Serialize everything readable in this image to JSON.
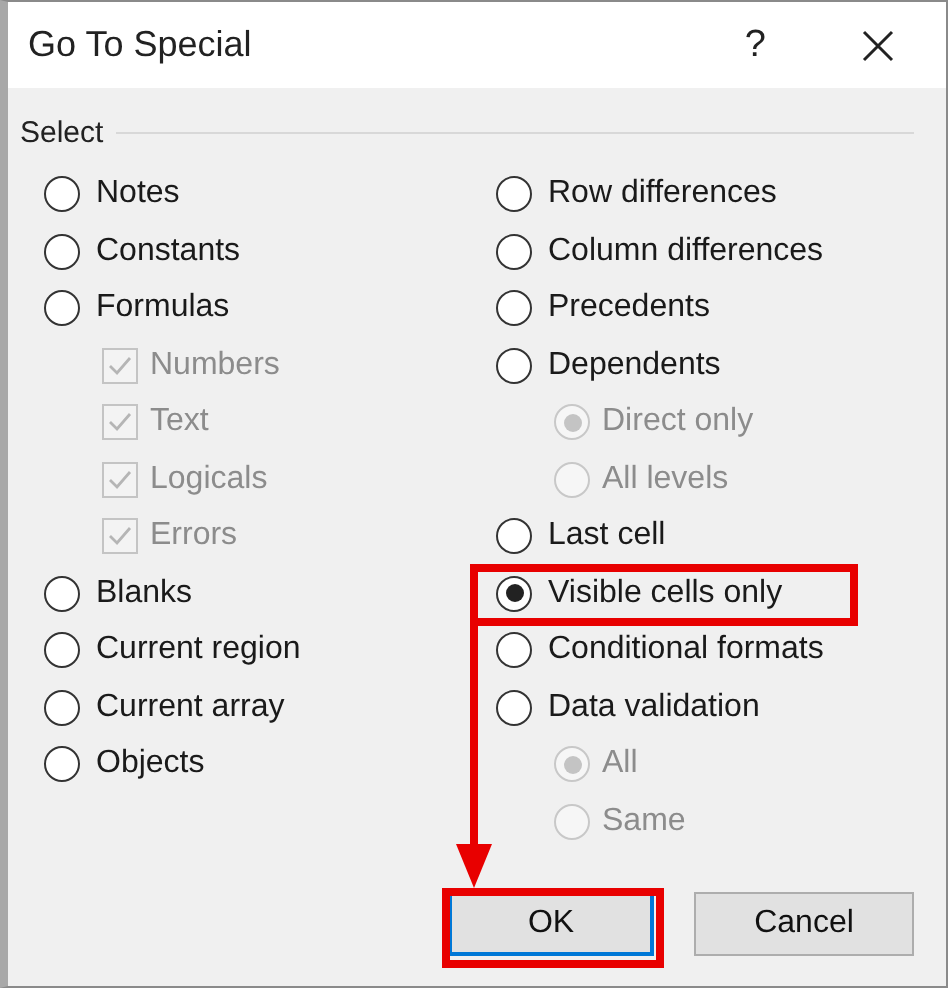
{
  "window": {
    "title": "Go To Special",
    "help": "?"
  },
  "group": {
    "label": "Select"
  },
  "columns": [
    [
      {
        "kind": "radio",
        "label": "Notes",
        "selected": false,
        "disabled": false
      },
      {
        "kind": "radio",
        "label": "Constants",
        "selected": false,
        "disabled": false
      },
      {
        "kind": "radio",
        "label": "Formulas",
        "selected": false,
        "disabled": false,
        "children": [
          {
            "kind": "checkbox",
            "label": "Numbers",
            "checked": true,
            "disabled": true
          },
          {
            "kind": "checkbox",
            "label": "Text",
            "checked": true,
            "disabled": true
          },
          {
            "kind": "checkbox",
            "label": "Logicals",
            "checked": true,
            "disabled": true
          },
          {
            "kind": "checkbox",
            "label": "Errors",
            "checked": true,
            "disabled": true
          }
        ]
      },
      {
        "kind": "radio",
        "label": "Blanks",
        "selected": false,
        "disabled": false
      },
      {
        "kind": "radio",
        "label": "Current region",
        "selected": false,
        "disabled": false
      },
      {
        "kind": "radio",
        "label": "Current array",
        "selected": false,
        "disabled": false
      },
      {
        "kind": "radio",
        "label": "Objects",
        "selected": false,
        "disabled": false
      }
    ],
    [
      {
        "kind": "radio",
        "label": "Row differences",
        "selected": false,
        "disabled": false
      },
      {
        "kind": "radio",
        "label": "Column differences",
        "selected": false,
        "disabled": false
      },
      {
        "kind": "radio",
        "label": "Precedents",
        "selected": false,
        "disabled": false
      },
      {
        "kind": "radio",
        "label": "Dependents",
        "selected": false,
        "disabled": false,
        "children": [
          {
            "kind": "radio",
            "label": "Direct only",
            "selected": true,
            "disabled": true
          },
          {
            "kind": "radio",
            "label": "All levels",
            "selected": false,
            "disabled": true
          }
        ]
      },
      {
        "kind": "radio",
        "label": "Last cell",
        "selected": false,
        "disabled": false
      },
      {
        "kind": "radio",
        "label": "Visible cells only",
        "selected": true,
        "disabled": false
      },
      {
        "kind": "radio",
        "label": "Conditional formats",
        "selected": false,
        "disabled": false
      },
      {
        "kind": "radio",
        "label": "Data validation",
        "selected": false,
        "disabled": false,
        "children": [
          {
            "kind": "radio",
            "label": "All",
            "selected": true,
            "disabled": true
          },
          {
            "kind": "radio",
            "label": "Same",
            "selected": false,
            "disabled": true
          }
        ]
      }
    ]
  ],
  "buttons": [
    {
      "label": "OK",
      "default": true
    },
    {
      "label": "Cancel",
      "default": false
    }
  ]
}
